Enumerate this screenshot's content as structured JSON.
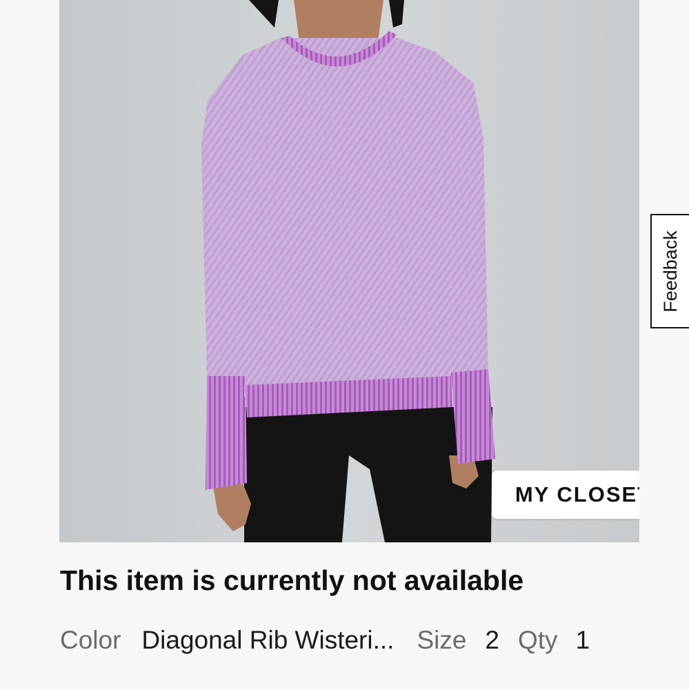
{
  "product": {
    "image_alt": "Long-sleeve knit top in purple diagonal rib on model",
    "closet_button_label": "MY CLOSET",
    "status_heading": "This item is currently not available",
    "attributes": {
      "color_label": "Color",
      "color_value": "Diagonal Rib Wisteri...",
      "size_label": "Size",
      "size_value": "2",
      "qty_label": "Qty",
      "qty_value": "1"
    }
  },
  "feedback": {
    "label": "Feedback"
  },
  "colors": {
    "page_background": "#f7f7f7",
    "image_background": "#cfd2d4",
    "garment": "#c9a8d9",
    "garment_trim": "#b070c4",
    "leggings": "#141414"
  }
}
